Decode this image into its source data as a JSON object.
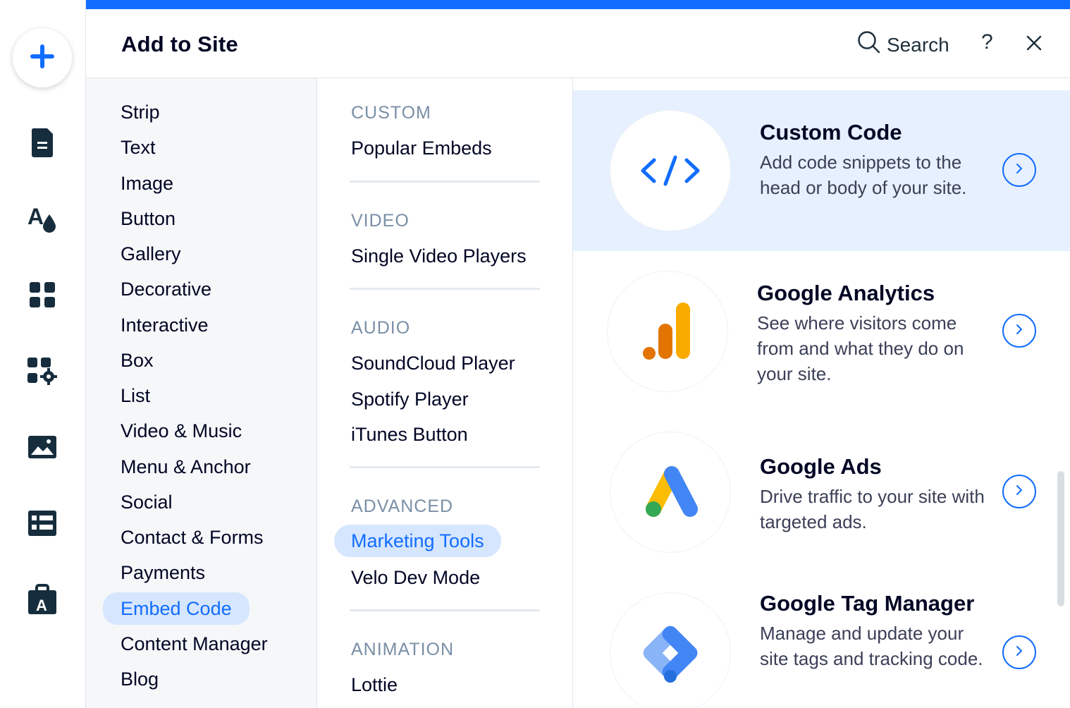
{
  "colors": {
    "accent": "#116dff",
    "highlight": "#e7f0ff",
    "active_bg": "#d6e6fe"
  },
  "left_rail": {
    "icons": [
      "plus-icon",
      "pages-icon",
      "design-icon",
      "apps-icon",
      "add-apps-icon",
      "media-icon",
      "cms-icon",
      "business-icon"
    ]
  },
  "header": {
    "title": "Add to Site",
    "search_label": "Search",
    "help_label": "?"
  },
  "categories": [
    "Strip",
    "Text",
    "Image",
    "Button",
    "Gallery",
    "Decorative",
    "Interactive",
    "Box",
    "List",
    "Video & Music",
    "Menu & Anchor",
    "Social",
    "Contact & Forms",
    "Payments",
    "Embed Code",
    "Content Manager",
    "Blog"
  ],
  "active_category": "Embed Code",
  "sections": [
    {
      "heading": "CUSTOM",
      "items": [
        "Popular Embeds"
      ]
    },
    {
      "heading": "VIDEO",
      "items": [
        "Single Video Players"
      ]
    },
    {
      "heading": "AUDIO",
      "items": [
        "SoundCloud Player",
        "Spotify Player",
        "iTunes Button"
      ]
    },
    {
      "heading": "ADVANCED",
      "items": [
        "Marketing Tools",
        "Velo Dev Mode"
      ]
    },
    {
      "heading": "ANIMATION",
      "items": [
        "Lottie"
      ]
    }
  ],
  "active_subcategory": "Marketing Tools",
  "cards": [
    {
      "title": "Custom Code",
      "description": "Add code snippets to the head or body of your site.",
      "icon": "code-icon"
    },
    {
      "title": "Google Analytics",
      "description": "See where visitors come from and what they do on your site.",
      "icon": "google-analytics-icon"
    },
    {
      "title": "Google Ads",
      "description": "Drive traffic to your site with targeted ads.",
      "icon": "google-ads-icon"
    },
    {
      "title": "Google Tag Manager",
      "description": "Manage and update your site tags and tracking code.",
      "icon": "google-tag-manager-icon"
    }
  ]
}
